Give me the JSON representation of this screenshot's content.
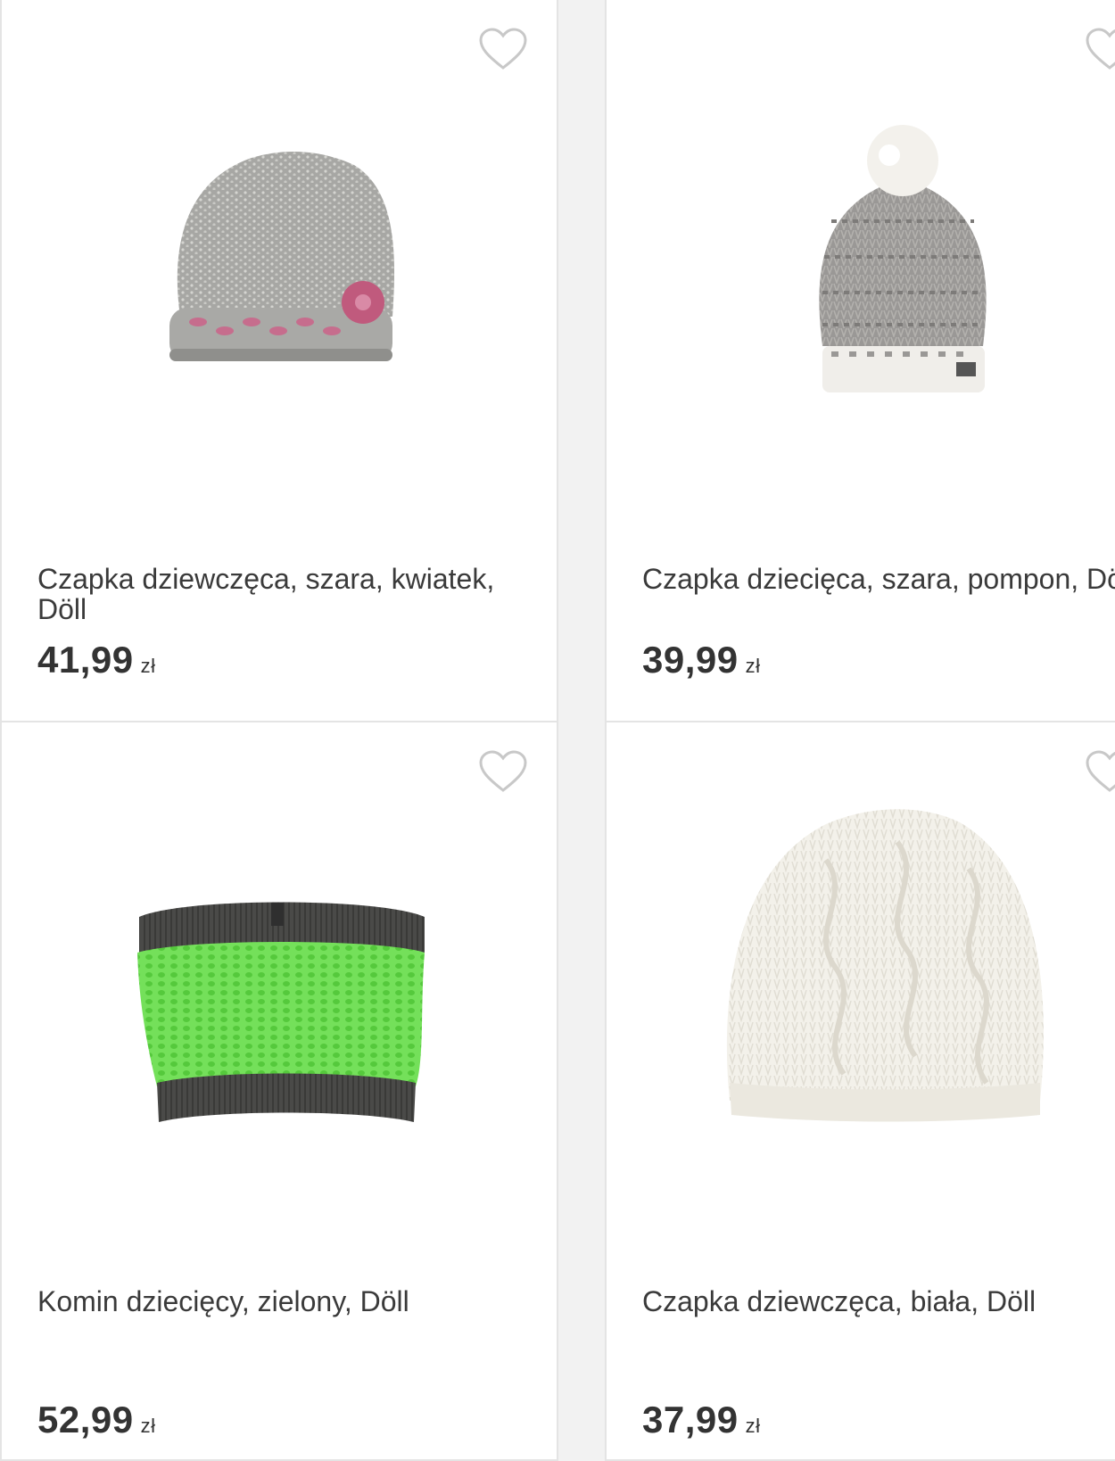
{
  "products": [
    {
      "title": "Czapka dziewczęca, szara, kwiatek, Döll",
      "price": "41,99",
      "currency": "zł",
      "icon": "heart-outline-icon",
      "image": "grey knitted hat with pink flower"
    },
    {
      "title": "Czapka dziecięca, szara, pompon, Döll",
      "price": "39,99",
      "currency": "zł",
      "icon": "heart-outline-icon",
      "image": "grey knitted hat with white pompon"
    },
    {
      "title": "Komin dziecięcy, zielony, Döll",
      "price": "52,99",
      "currency": "zł",
      "icon": "heart-outline-icon",
      "image": "green and dark grey knitted snood"
    },
    {
      "title": "Czapka dziewczęca, biała, Döll",
      "price": "37,99",
      "currency": "zł",
      "icon": "heart-outline-icon",
      "image": "white cable knit hat"
    }
  ]
}
